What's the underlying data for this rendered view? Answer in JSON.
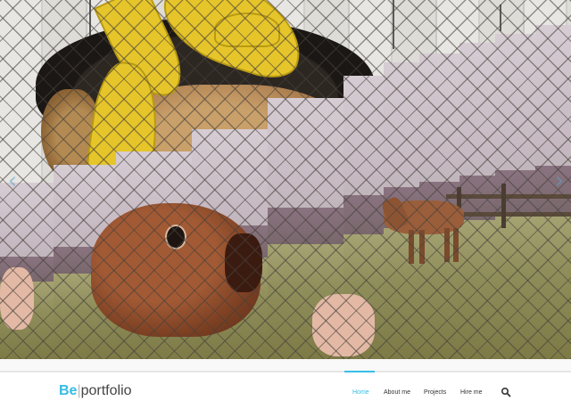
{
  "brand": {
    "logo_be": "Be",
    "logo_separator": "|",
    "logo_text": "portfolio"
  },
  "nav": {
    "items": [
      {
        "label": "Home",
        "active": true
      },
      {
        "label": "About me",
        "active": false
      },
      {
        "label": "Projects",
        "active": false
      },
      {
        "label": "Hire me",
        "active": false
      }
    ],
    "search_icon": "search-icon"
  },
  "slider": {
    "prev_arrow": "‹",
    "next_arrow": "›"
  },
  "colors": {
    "accent": "#35bce3",
    "text": "#333333"
  }
}
